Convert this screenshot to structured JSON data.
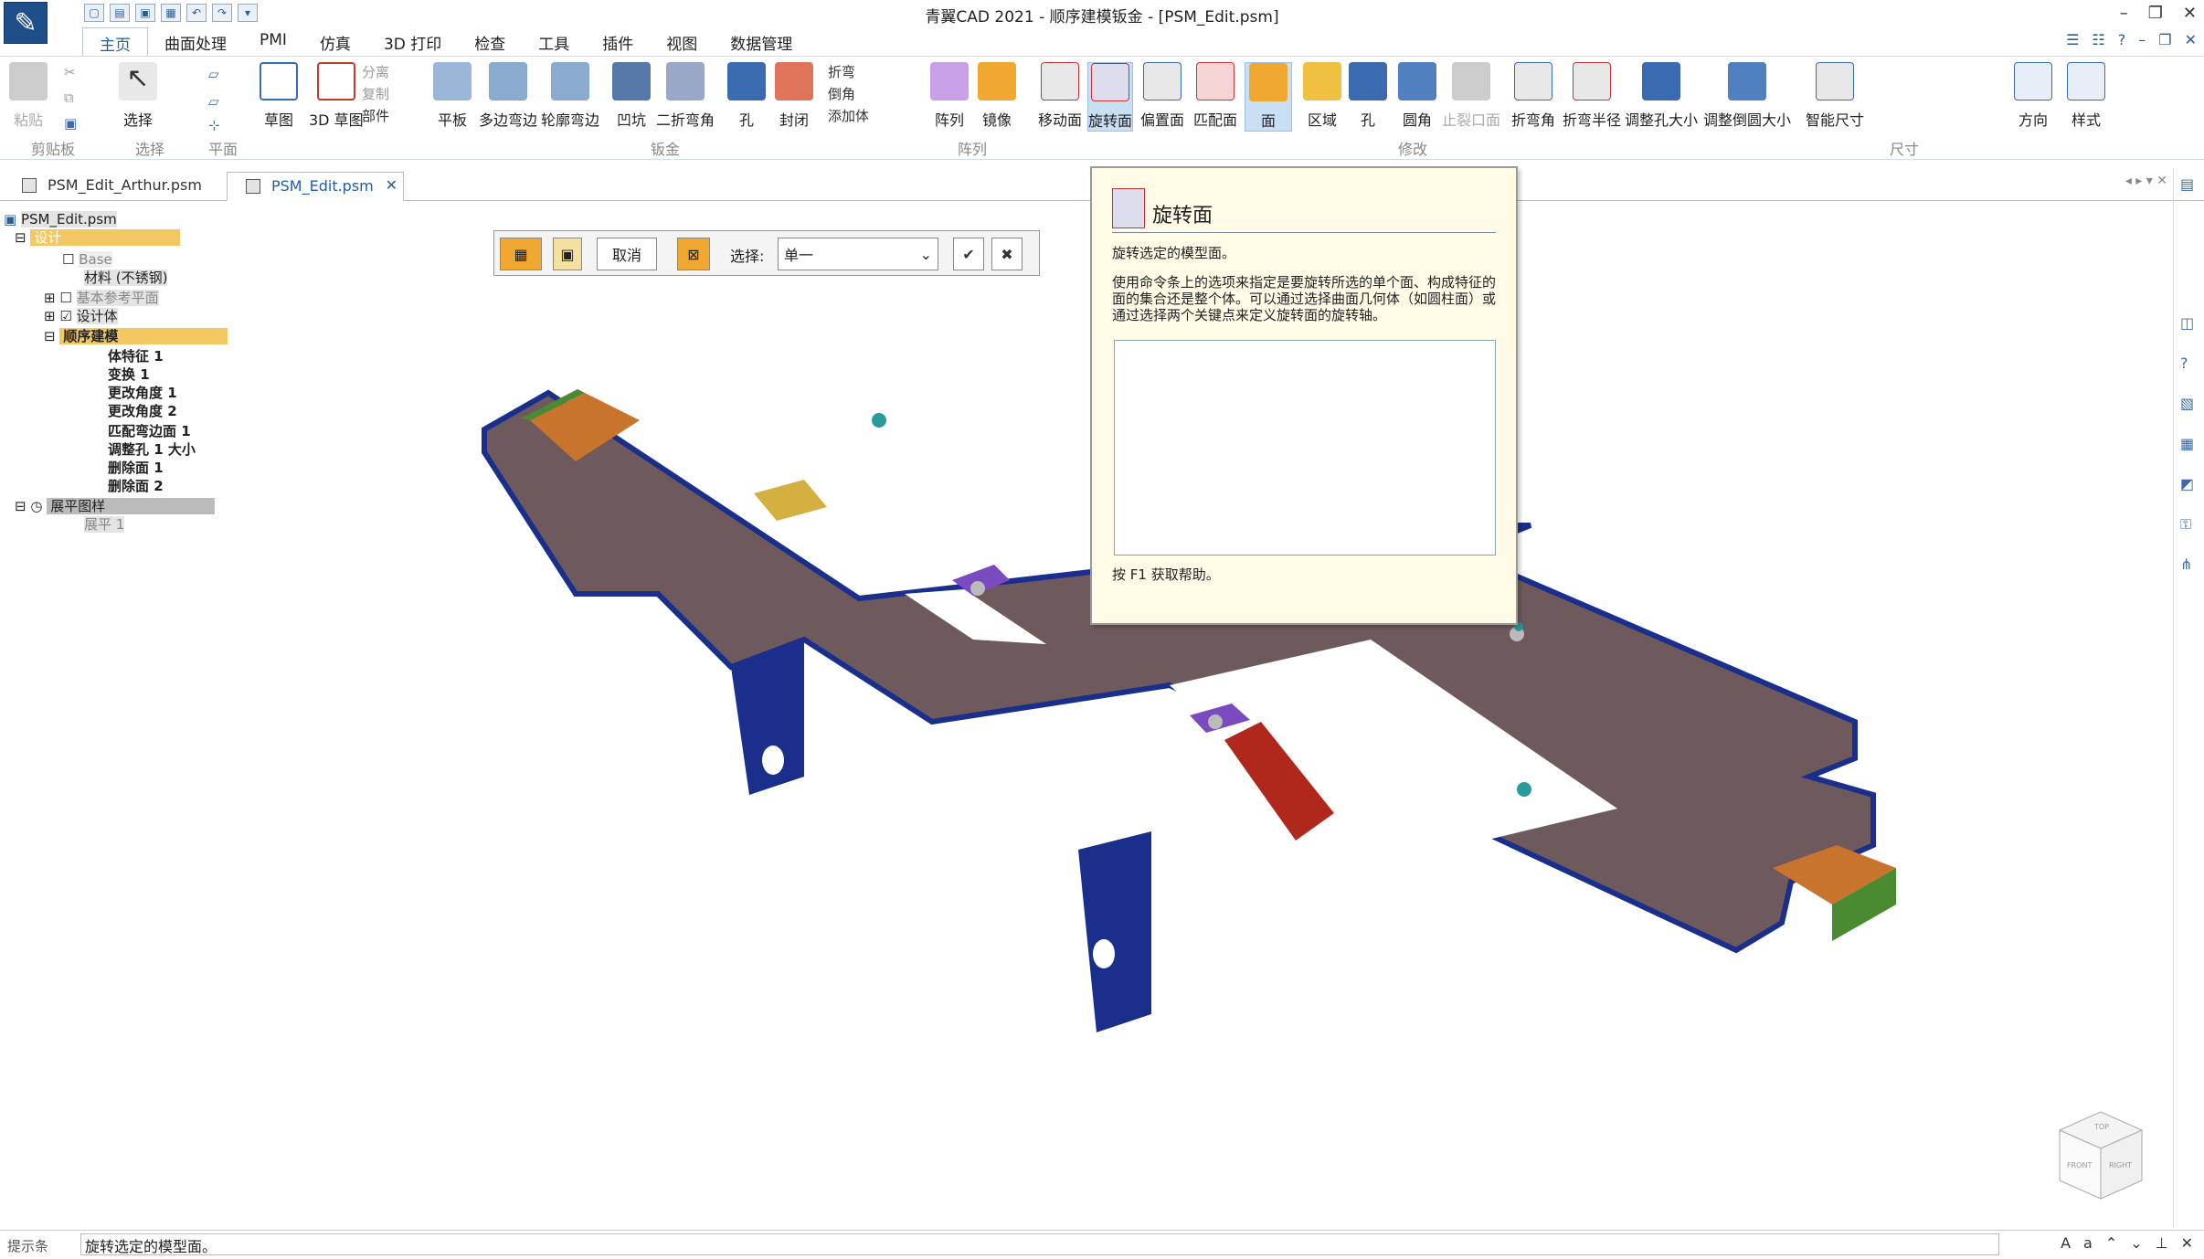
{
  "window": {
    "title": "青翼CAD 2021 - 顺序建模钣金 - [PSM_Edit.psm]"
  },
  "ribbon_tabs": [
    "主页",
    "曲面处理",
    "PMI",
    "仿真",
    "3D 打印",
    "检查",
    "工具",
    "插件",
    "视图",
    "数据管理"
  ],
  "ribbon": {
    "clipboard": {
      "paste": "粘贴",
      "group": "剪贴板"
    },
    "select": {
      "label": "选择",
      "group": "选择"
    },
    "plane": {
      "group": "平面"
    },
    "sketch": {
      "sketch": "草图",
      "sketch3d": "3D 草图",
      "split": "分离",
      "copy": "复制",
      "part": "部件"
    },
    "sheetmetal": {
      "tab": "平板",
      "multiedge": "多边弯边",
      "contour": "轮廓弯边",
      "dimple": "凹坑",
      "twofold": "二折弯角",
      "hole": "孔",
      "closecorner": "封闭",
      "fold": "折弯",
      "chamfer": "倒角",
      "addbody": "添加体",
      "group": "钣金"
    },
    "pattern": {
      "array": "阵列",
      "mirror": "镜像",
      "group": "阵列"
    },
    "modify": {
      "move": "移动面",
      "rotate": "旋转面",
      "offset": "偏置面",
      "match": "匹配面",
      "face": "面",
      "region": "区域",
      "hole": "孔",
      "round": "圆角",
      "relief": "止裂口面",
      "bendangle": "折弯角",
      "bendradius": "折弯半径",
      "holesize": "调整孔大小",
      "roundsize": "调整倒圆大小",
      "group": "修改"
    },
    "dimension": {
      "smart": "智能尺寸",
      "group": "尺寸"
    },
    "orient": {
      "label": "方向"
    },
    "style": {
      "label": "样式"
    }
  },
  "doc_tabs": [
    {
      "label": "PSM_Edit_Arthur.psm",
      "active": false
    },
    {
      "label": "PSM_Edit.psm",
      "active": true
    }
  ],
  "tree": {
    "root": "PSM_Edit.psm",
    "design": "设计",
    "base": "Base",
    "material": "材料 (不锈钢)",
    "refplanes": "基本参考平面",
    "designbody": "设计体",
    "synch": "顺序建模",
    "features": [
      "体特征 1",
      "变换 1",
      "更改角度 1",
      "更改角度 2",
      "匹配弯边面 1",
      "调整孔 1 大小",
      "删除面 1",
      "删除面 2"
    ],
    "flat": "展平图样",
    "flat1": "展平 1"
  },
  "cmdbar": {
    "cancel": "取消",
    "select_label": "选择:",
    "select_value": "单一"
  },
  "tooltip": {
    "title": "旋转面",
    "line1": "旋转选定的模型面。",
    "desc": "使用命令条上的选项来指定是要旋转所选的单个面、构成特征的面的集合还是整个体。可以通过选择曲面几何体（如圆柱面）或通过选择两个关键点来定义旋转面的旋转轴。",
    "help": "按 F1 获取帮助。"
  },
  "status": {
    "label": "提示条",
    "message": "旋转选定的模型面。"
  },
  "viewcube": {
    "front": "FRONT",
    "right": "RIGHT",
    "top": "TOP"
  },
  "colors": {
    "accent": "#1f5fa8",
    "plate": "#6e5a5c",
    "edge": "#1a2e8c",
    "orange": "#c8742c",
    "green": "#4a8a30",
    "purple": "#7a4ac0",
    "red": "#b0281c"
  }
}
